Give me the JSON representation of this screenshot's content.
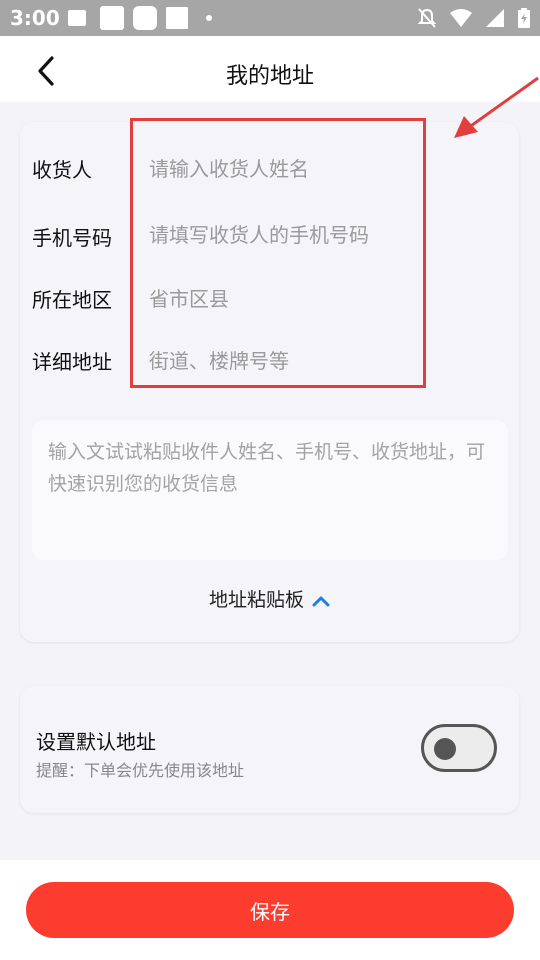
{
  "status_bar": {
    "time": "3:00"
  },
  "header": {
    "title": "我的地址"
  },
  "form": {
    "recipient": {
      "label": "收货人",
      "placeholder": "请输入收货人姓名"
    },
    "phone": {
      "label": "手机号码",
      "placeholder": "请填写收货人的手机号码"
    },
    "region": {
      "label": "所在地区",
      "placeholder": "省市区县"
    },
    "address": {
      "label": "详细地址",
      "placeholder": "街道、楼牌号等"
    }
  },
  "paste": {
    "placeholder": "输入文试试粘贴收件人姓名、手机号、收货地址，可快速识别您的收货信息",
    "toggle_label": "地址粘贴板"
  },
  "default_address": {
    "title": "设置默认地址",
    "hint": "提醒：下单会优先使用该地址",
    "enabled": false
  },
  "save_label": "保存",
  "colors": {
    "accent": "#fb3c2f",
    "highlight": "#e23e3e",
    "link": "#1e7fe0"
  }
}
